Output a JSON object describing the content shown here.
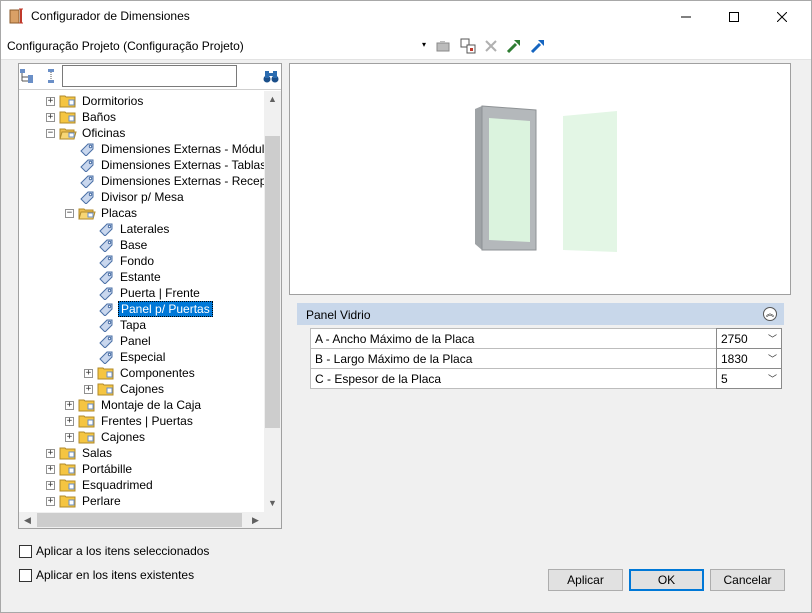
{
  "window": {
    "title": "Configurador de Dimensiones"
  },
  "config": {
    "label": "Configuração Projeto (Configuração Projeto)",
    "dropdown_arrow": "▾"
  },
  "search": {
    "value": ""
  },
  "tree": [
    {
      "label": "Dormitorios",
      "level": 1,
      "expander": "+",
      "icon": "folder-icon"
    },
    {
      "label": "Baños",
      "level": 1,
      "expander": "+",
      "icon": "folder-icon"
    },
    {
      "label": "Oficinas",
      "level": 1,
      "expander": "−",
      "icon": "folder-open-icon"
    },
    {
      "label": "Dimensiones Externas - Módulos",
      "level": 2,
      "expander": "",
      "icon": "tag-icon"
    },
    {
      "label": "Dimensiones Externas - Tablas",
      "level": 2,
      "expander": "",
      "icon": "tag-icon"
    },
    {
      "label": "Dimensiones Externas - Recepción",
      "level": 2,
      "expander": "",
      "icon": "tag-icon"
    },
    {
      "label": "Divisor p/ Mesa",
      "level": 2,
      "expander": "",
      "icon": "tag-icon"
    },
    {
      "label": "Placas",
      "level": 2,
      "expander": "−",
      "icon": "folder-open-icon"
    },
    {
      "label": "Laterales",
      "level": 3,
      "expander": "",
      "icon": "tag-icon"
    },
    {
      "label": "Base",
      "level": 3,
      "expander": "",
      "icon": "tag-icon"
    },
    {
      "label": "Fondo",
      "level": 3,
      "expander": "",
      "icon": "tag-icon"
    },
    {
      "label": "Estante",
      "level": 3,
      "expander": "",
      "icon": "tag-icon"
    },
    {
      "label": "Puerta | Frente",
      "level": 3,
      "expander": "",
      "icon": "tag-icon"
    },
    {
      "label": "Panel p/ Puertas",
      "level": 3,
      "expander": "",
      "icon": "tag-icon",
      "selected": true
    },
    {
      "label": "Tapa",
      "level": 3,
      "expander": "",
      "icon": "tag-icon"
    },
    {
      "label": "Panel",
      "level": 3,
      "expander": "",
      "icon": "tag-icon"
    },
    {
      "label": "Especial",
      "level": 3,
      "expander": "",
      "icon": "tag-icon"
    },
    {
      "label": "Componentes",
      "level": 3,
      "expander": "+",
      "icon": "folder-icon"
    },
    {
      "label": "Cajones",
      "level": 3,
      "expander": "+",
      "icon": "folder-icon"
    },
    {
      "label": "Montaje de la Caja",
      "level": 2,
      "expander": "+",
      "icon": "folder-icon"
    },
    {
      "label": "Frentes | Puertas",
      "level": 2,
      "expander": "+",
      "icon": "folder-icon"
    },
    {
      "label": "Cajones",
      "level": 2,
      "expander": "+",
      "icon": "folder-icon"
    },
    {
      "label": "Salas",
      "level": 1,
      "expander": "+",
      "icon": "folder-icon"
    },
    {
      "label": "Portábille",
      "level": 1,
      "expander": "+",
      "icon": "folder-icon"
    },
    {
      "label": "Esquadrimed",
      "level": 1,
      "expander": "+",
      "icon": "folder-icon"
    },
    {
      "label": "Perlare",
      "level": 1,
      "expander": "+",
      "icon": "folder-icon"
    }
  ],
  "properties": {
    "group_title": "Panel Vidrio",
    "rows": [
      {
        "name": "A -  Ancho Máximo de la Placa",
        "value": "2750"
      },
      {
        "name": "B - Largo Máximo de la Placa",
        "value": "1830"
      },
      {
        "name": "C - Espesor de la Placa",
        "value": "5"
      }
    ]
  },
  "options": {
    "apply_selected": "Aplicar a los itens seleccionados",
    "apply_existing": "Aplicar en los itens existentes"
  },
  "buttons": {
    "apply": "Aplicar",
    "ok": "OK",
    "cancel": "Cancelar"
  },
  "colors": {
    "selection": "#0078d7",
    "group_header": "#c8d7ea",
    "folder": "#f5c542"
  }
}
